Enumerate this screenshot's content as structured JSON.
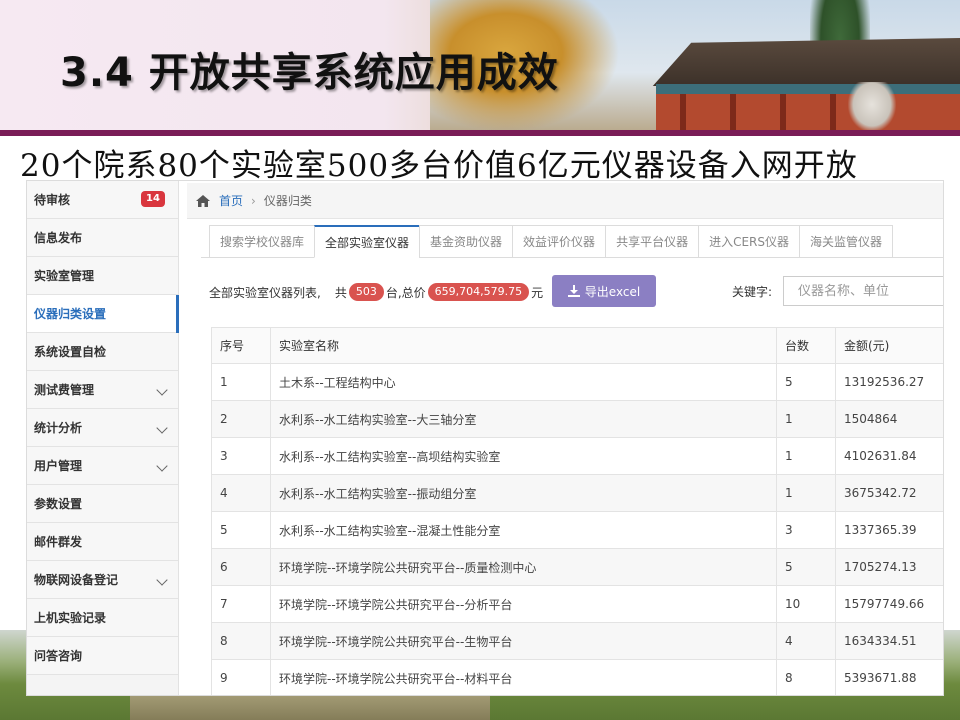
{
  "slide": {
    "title": "3.4 开放共享系统应用成效",
    "subheading": "20个院系80个实验室500多台价值6亿元仪器设备入网开放"
  },
  "sidebar": {
    "items": [
      {
        "label": "待审核",
        "badge": "14"
      },
      {
        "label": "信息发布"
      },
      {
        "label": "实验室管理"
      },
      {
        "label": "仪器归类设置",
        "active": true
      },
      {
        "label": "系统设置自检"
      },
      {
        "label": "测试费管理",
        "expandable": true
      },
      {
        "label": "统计分析",
        "expandable": true
      },
      {
        "label": "用户管理",
        "expandable": true
      },
      {
        "label": "参数设置"
      },
      {
        "label": "邮件群发"
      },
      {
        "label": "物联网设备登记",
        "expandable": true
      },
      {
        "label": "上机实验记录"
      },
      {
        "label": "问答咨询"
      }
    ]
  },
  "breadcrumb": {
    "home": "首页",
    "current": "仪器归类"
  },
  "tabs": [
    {
      "label": "搜索学校仪器库"
    },
    {
      "label": "全部实验室仪器",
      "active": true
    },
    {
      "label": "基金资助仪器"
    },
    {
      "label": "效益评价仪器"
    },
    {
      "label": "共享平台仪器"
    },
    {
      "label": "进入CERS仪器"
    },
    {
      "label": "海关监管仪器"
    }
  ],
  "summary": {
    "prefix": "全部实验室仪器列表,",
    "count_prefix": "共",
    "count": "503",
    "count_suffix": "台,总价",
    "total": "659,704,579.75",
    "total_suffix": "元"
  },
  "export_button": "导出excel",
  "search": {
    "label": "关键字:",
    "placeholder": "仪器名称、单位"
  },
  "table": {
    "headers": [
      "序号",
      "实验室名称",
      "台数",
      "金额(元)"
    ],
    "rows": [
      [
        "1",
        "土木系--工程结构中心",
        "5",
        "13192536.27"
      ],
      [
        "2",
        "水利系--水工结构实验室--大三轴分室",
        "1",
        "1504864"
      ],
      [
        "3",
        "水利系--水工结构实验室--高坝结构实验室",
        "1",
        "4102631.84"
      ],
      [
        "4",
        "水利系--水工结构实验室--振动组分室",
        "1",
        "3675342.72"
      ],
      [
        "5",
        "水利系--水工结构实验室--混凝土性能分室",
        "3",
        "1337365.39"
      ],
      [
        "6",
        "环境学院--环境学院公共研究平台--质量检测中心",
        "5",
        "1705274.13"
      ],
      [
        "7",
        "环境学院--环境学院公共研究平台--分析平台",
        "10",
        "15797749.66"
      ],
      [
        "8",
        "环境学院--环境学院公共研究平台--生物平台",
        "4",
        "1634334.51"
      ],
      [
        "9",
        "环境学院--环境学院公共研究平台--材料平台",
        "8",
        "5393671.88"
      ]
    ]
  },
  "colors": {
    "accent": "#2a6ebb",
    "badge": "#d9363e",
    "pill": "#d9534f",
    "export": "#8b7fc3",
    "header_rule": "#7a1d57"
  }
}
